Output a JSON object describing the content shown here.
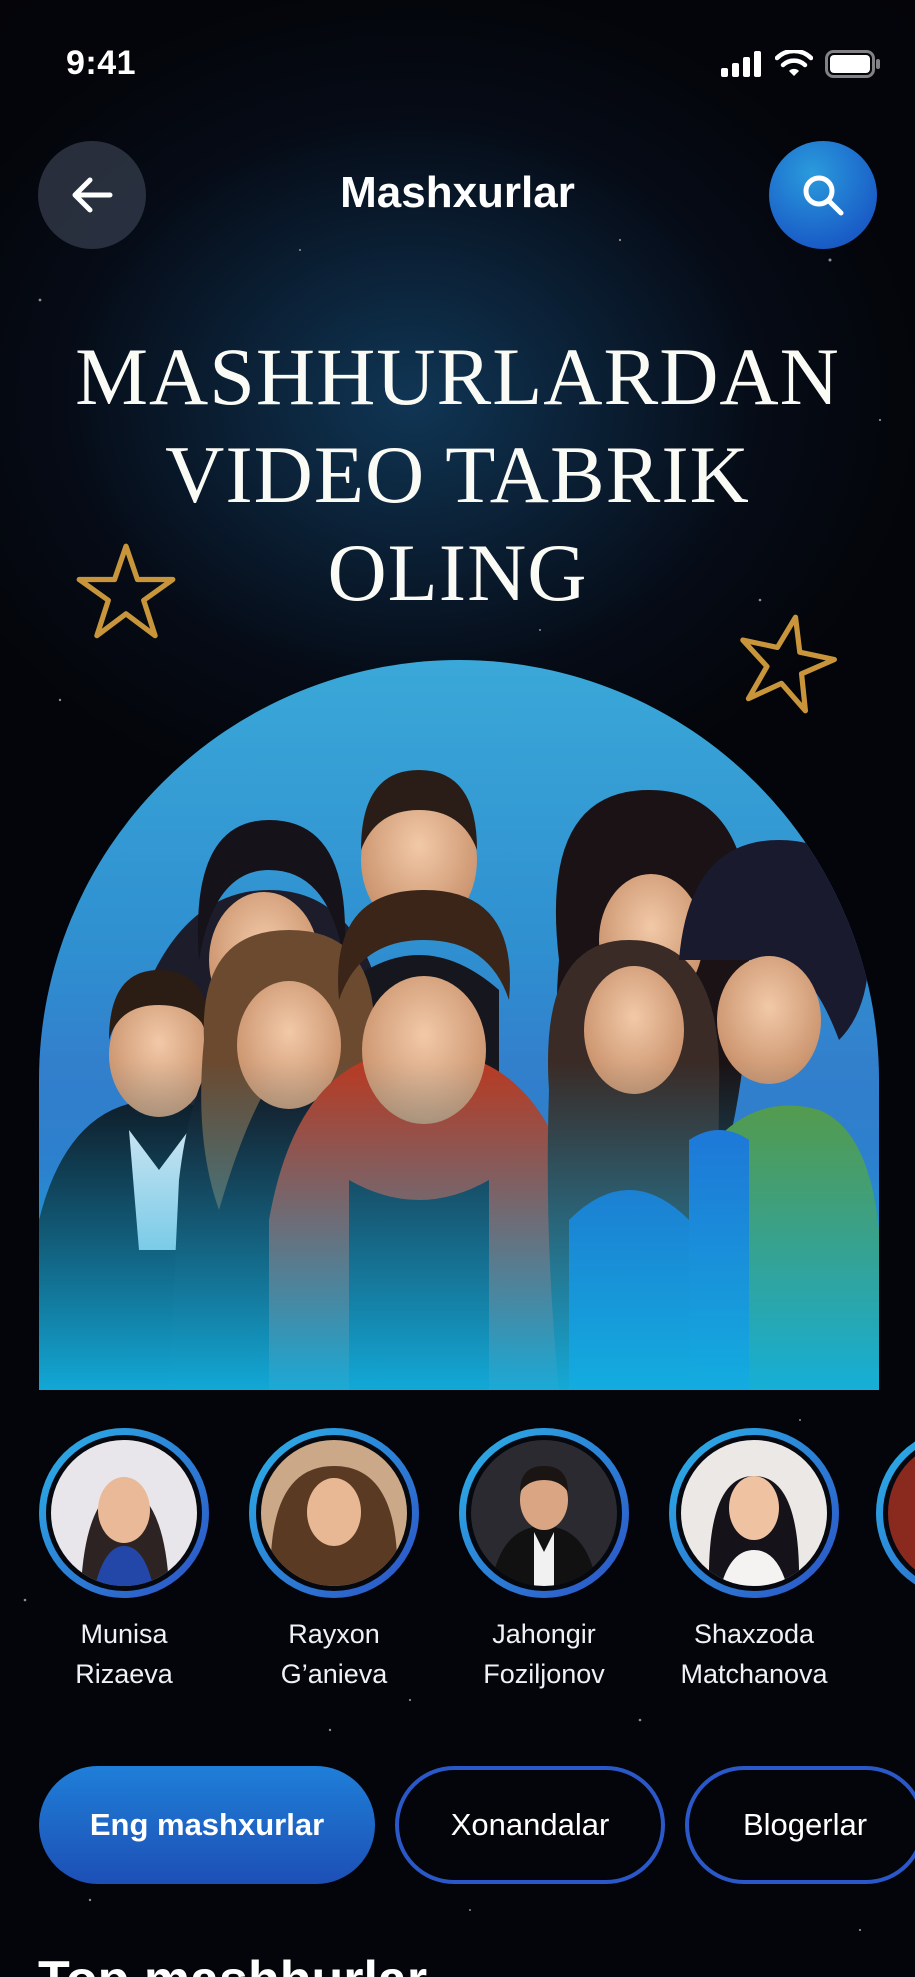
{
  "status_bar": {
    "time": "9:41"
  },
  "header": {
    "title": "Mashxurlar",
    "back_icon": "arrow-left-icon",
    "search_icon": "search-icon"
  },
  "hero": {
    "lines": [
      "MASHHURLARDAN",
      "VIDEO TABRIK",
      "OLING"
    ]
  },
  "celebrities": [
    {
      "first": "Munisa",
      "last": "Rizaeva"
    },
    {
      "first": "Rayxon",
      "last": "G’anieva"
    },
    {
      "first": "Jahongir",
      "last": "Foziljonov"
    },
    {
      "first": "Shaxzoda",
      "last": "Matchanova"
    }
  ],
  "filters": [
    {
      "label": "Eng mashxurlar",
      "active": true
    },
    {
      "label": "Xonandalar",
      "active": false
    },
    {
      "label": "Blogerlar",
      "active": false
    }
  ],
  "section": {
    "title": "Top mashhurlar"
  },
  "colors": {
    "accent": "#1f6fd0",
    "accent_light": "#2bb3e8",
    "background": "#04050a",
    "star_gold": "#c9953a"
  }
}
